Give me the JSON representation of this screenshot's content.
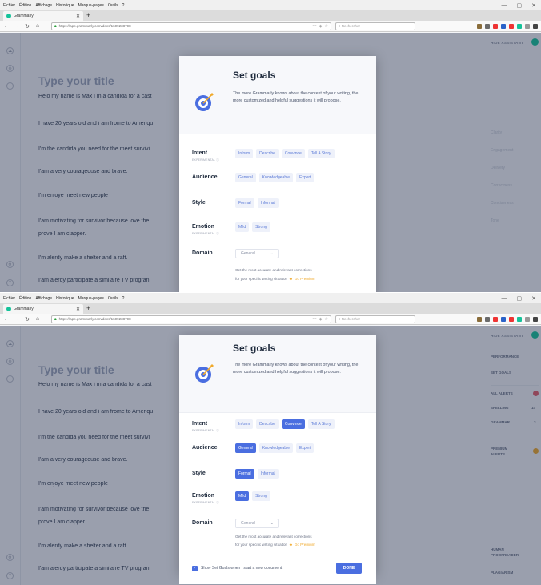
{
  "browser": {
    "menu": [
      "Fichier",
      "Édition",
      "Affichage",
      "Historique",
      "Marque-pages",
      "Outils",
      "?"
    ],
    "tab_title": "Grammarly",
    "tab_close": "✕",
    "tab_new": "+",
    "url": "https://app.grammarly.com/docs/1609238798",
    "url_zoom": "•••",
    "search_placeholder": "Rechercher",
    "win_min": "—",
    "win_max": "▢",
    "win_close": "✕"
  },
  "editor": {
    "title_placeholder": "Type your title",
    "lines": [
      "Helo my name is Max i m a candida for a cast",
      "I have 20 years old and i am frome to Ameriqu",
      "I'm the candida you need for the meet survivi",
      "I'am a very courageouse and brave.",
      "I'm enjoye meet new people",
      "I'am motivating for survivor because love the",
      "prove I am clapper.",
      "I'm alerdy make a shelter and a raft.",
      "I'am alerdy participate a similaire TV progran"
    ]
  },
  "right_panel": {
    "assistant": "HIDE ASSISTANT",
    "top_items": [
      "Clarity",
      "Engagement",
      "Delivery",
      "Correctness",
      "Conciseness",
      "Tone"
    ],
    "performance": "PERFORMANCE",
    "set_goals": "SET GOALS",
    "all_alerts": "ALL ALERTS",
    "spelling": "SPELLING",
    "spelling_count": "14",
    "grammar": "GRAMMAR",
    "grammar_count": "3",
    "premium": "PREMIUM ALERTS",
    "human_proofreader": "HUMAN PROOFREADER",
    "plagiarism": "PLAGIARISM"
  },
  "modal": {
    "title": "Set goals",
    "description": "The more Grammarly knows about the context of your writing, the more customized and helpful suggestions it will propose.",
    "intent_label": "Intent",
    "intent_sub": "EXPERIMENTAL ⓘ",
    "intent_options": [
      "Inform",
      "Describe",
      "Convince",
      "Tell A Story"
    ],
    "audience_label": "Audience",
    "audience_options": [
      "General",
      "Knowledgeable",
      "Expert"
    ],
    "style_label": "Style",
    "style_options": [
      "Formal",
      "Informal"
    ],
    "emotion_label": "Emotion",
    "emotion_sub": "EXPERIMENTAL ⓘ",
    "emotion_options": [
      "Mild",
      "Strong"
    ],
    "domain_label": "Domain",
    "domain_value": "General",
    "domain_note_1": "Get the most accurate and relevant corrections",
    "domain_note_2": "for your specific writing situation",
    "learn_more": "Go Premium",
    "show_goals": "Show Set Goals when I start a new document",
    "done": "DONE"
  },
  "colors": {
    "accent": "#4a6ee0",
    "grammarly_green": "#15c39a",
    "alert_red": "#e35d6a",
    "premium_yellow": "#f0a92b"
  }
}
